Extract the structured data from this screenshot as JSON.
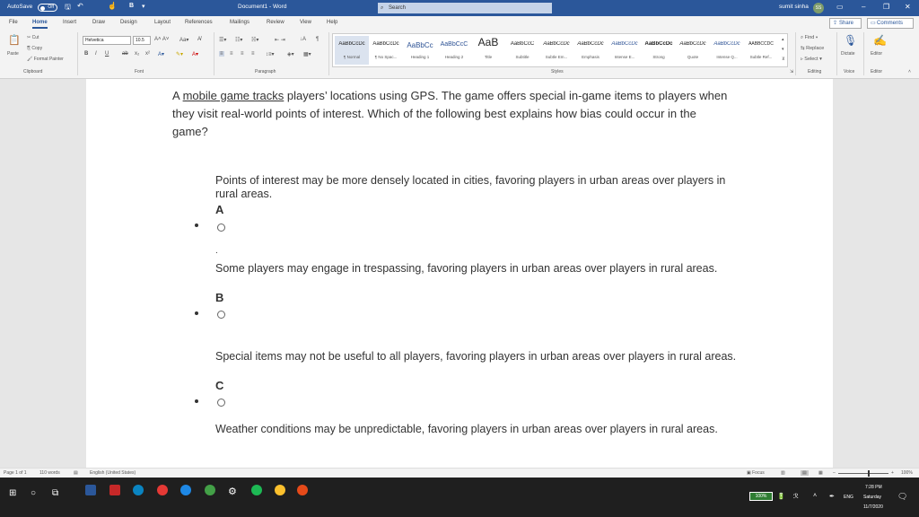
{
  "titlebar": {
    "autosave_label": "AutoSave",
    "autosave_state": "Off",
    "doc_title": "Document1 - Word",
    "search_placeholder": "Search",
    "user_name": "sumit sinha",
    "user_initials": "SS"
  },
  "tabs": [
    "File",
    "Home",
    "Insert",
    "Draw",
    "Design",
    "Layout",
    "References",
    "Mailings",
    "Review",
    "View",
    "Help"
  ],
  "active_tab": "Home",
  "share_label": "Share",
  "comments_label": "Comments",
  "clipboard": {
    "paste": "Paste",
    "cut": "Cut",
    "copy": "Copy",
    "format_painter": "Format Painter",
    "group": "Clipboard"
  },
  "font": {
    "name": "Helvetica",
    "size": "10.5",
    "group": "Font"
  },
  "paragraph_group": "Paragraph",
  "styles": {
    "items": [
      {
        "sample": "AaBbCcDc",
        "name": "¶ Normal"
      },
      {
        "sample": "AaBbCcDc",
        "name": "¶ No Spac..."
      },
      {
        "sample": "AaBbCc",
        "name": "Heading 1"
      },
      {
        "sample": "AaBbCcC",
        "name": "Heading 2"
      },
      {
        "sample": "AaB",
        "name": "Title"
      },
      {
        "sample": "AaBbCcC",
        "name": "Subtitle"
      },
      {
        "sample": "AaBbCcDc",
        "name": "Subtle Em..."
      },
      {
        "sample": "AaBbCcDc",
        "name": "Emphasis"
      },
      {
        "sample": "AaBbCcDc",
        "name": "Intense E..."
      },
      {
        "sample": "AaBbCcDc",
        "name": "Strong"
      },
      {
        "sample": "AaBbCcDc",
        "name": "Quote"
      },
      {
        "sample": "AaBbCcDc",
        "name": "Intense Q..."
      },
      {
        "sample": "AABBCCDC",
        "name": "Subtle Ref..."
      }
    ],
    "group": "Styles"
  },
  "editing": {
    "find": "Find",
    "replace": "Replace",
    "select": "Select",
    "group": "Editing"
  },
  "voice": {
    "dictate": "Dictate",
    "group": "Voice"
  },
  "editor": {
    "label": "Editor",
    "group": "Editor"
  },
  "document": {
    "question_lead": "A ",
    "question_link": "mobile game tracks",
    "question_rest": " players’ locations using GPS. The game offers special in-game items to players when they visit real-world points of interest. Which of the following best explains how bias could occur in the game?",
    "options": [
      {
        "text": "Points of interest may be more densely located in cities, favoring players in urban areas over players in rural areas.",
        "letter": "A"
      },
      {
        "text": "Some players may engage in trespassing, favoring players in urban areas over players in rural areas.",
        "letter": "B"
      },
      {
        "text": "Special items may not be useful to all players, favoring players in urban areas over players in rural areas.",
        "letter": "C"
      },
      {
        "text": "Weather conditions may be unpredictable, favoring players in urban areas over players in rural areas."
      }
    ],
    "stray_dot": "."
  },
  "statusbar": {
    "page": "Page 1 of 1",
    "words": "110 words",
    "language": "English (United States)",
    "focus": "Focus",
    "zoom": "100%",
    "zoom_fraction": 0.6
  },
  "taskbar": {
    "battery": "100%",
    "lang": "ENG",
    "time": "7:28 PM",
    "day": "Saturday",
    "date": "11/7/2020"
  },
  "colors": {
    "word_blue": "#2b579a",
    "taskbar": "#1f1f1f"
  }
}
